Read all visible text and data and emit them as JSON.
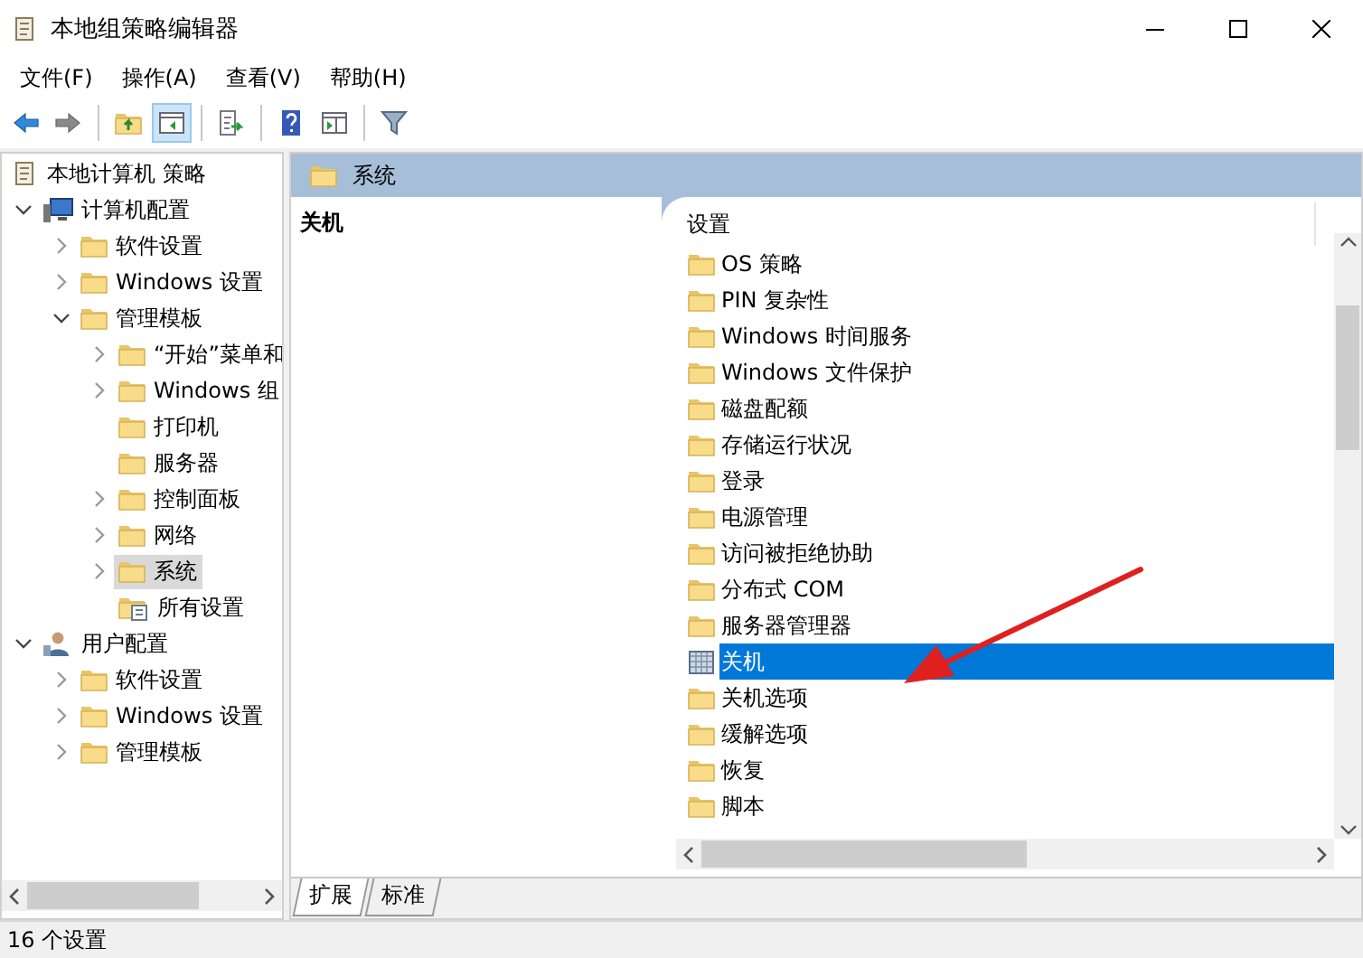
{
  "window": {
    "title": "本地组策略编辑器"
  },
  "menu": [
    {
      "label": "文件(F)"
    },
    {
      "label": "操作(A)"
    },
    {
      "label": "查看(V)"
    },
    {
      "label": "帮助(H)"
    }
  ],
  "toolbar": [
    {
      "kind": "back",
      "pressed": false
    },
    {
      "kind": "forward",
      "pressed": false
    },
    {
      "kind": "sep"
    },
    {
      "kind": "up",
      "pressed": false
    },
    {
      "kind": "tree",
      "pressed": true
    },
    {
      "kind": "sep"
    },
    {
      "kind": "export",
      "pressed": false
    },
    {
      "kind": "sep"
    },
    {
      "kind": "help",
      "pressed": false
    },
    {
      "kind": "panel",
      "pressed": false
    },
    {
      "kind": "sep"
    },
    {
      "kind": "filter",
      "pressed": false
    }
  ],
  "tree": {
    "root": {
      "label": "本地计算机 策略",
      "kind": "policy",
      "selected": false,
      "children": [
        {
          "label": "计算机配置",
          "kind": "computer",
          "expanded": true,
          "selected": false,
          "children": [
            {
              "label": "软件设置",
              "kind": "folder",
              "expanded": false,
              "selected": false
            },
            {
              "label": "Windows 设置",
              "kind": "folder",
              "expanded": false,
              "selected": false
            },
            {
              "label": "管理模板",
              "kind": "folder",
              "expanded": true,
              "selected": false,
              "children": [
                {
                  "label": "“开始”菜单和",
                  "kind": "folder",
                  "expanded": false,
                  "selected": false
                },
                {
                  "label": "Windows 组",
                  "kind": "folder",
                  "expanded": false,
                  "selected": false
                },
                {
                  "label": "打印机",
                  "kind": "folder",
                  "selected": false
                },
                {
                  "label": "服务器",
                  "kind": "folder",
                  "selected": false
                },
                {
                  "label": "控制面板",
                  "kind": "folder",
                  "expanded": false,
                  "selected": false
                },
                {
                  "label": "网络",
                  "kind": "folder",
                  "expanded": false,
                  "selected": false
                },
                {
                  "label": "系统",
                  "kind": "folder",
                  "expanded": false,
                  "selected": true
                },
                {
                  "label": "所有设置",
                  "kind": "settings",
                  "selected": false
                }
              ]
            }
          ]
        },
        {
          "label": "用户配置",
          "kind": "user",
          "expanded": true,
          "selected": false,
          "children": [
            {
              "label": "软件设置",
              "kind": "folder",
              "expanded": false,
              "selected": false
            },
            {
              "label": "Windows 设置",
              "kind": "folder",
              "expanded": false,
              "selected": false
            },
            {
              "label": "管理模板",
              "kind": "folder",
              "expanded": false,
              "selected": false
            }
          ]
        }
      ]
    }
  },
  "details": {
    "header": "系统",
    "description_title": "关机",
    "column": "设置",
    "items": [
      {
        "label": "OS 策略",
        "kind": "folder",
        "selected": false
      },
      {
        "label": "PIN 复杂性",
        "kind": "folder",
        "selected": false
      },
      {
        "label": "Windows 时间服务",
        "kind": "folder",
        "selected": false
      },
      {
        "label": "Windows 文件保护",
        "kind": "folder",
        "selected": false
      },
      {
        "label": "磁盘配额",
        "kind": "folder",
        "selected": false
      },
      {
        "label": "存储运行状况",
        "kind": "folder",
        "selected": false
      },
      {
        "label": "登录",
        "kind": "folder",
        "selected": false
      },
      {
        "label": "电源管理",
        "kind": "folder",
        "selected": false
      },
      {
        "label": "访问被拒绝协助",
        "kind": "folder",
        "selected": false
      },
      {
        "label": "分布式 COM",
        "kind": "folder",
        "selected": false
      },
      {
        "label": "服务器管理器",
        "kind": "folder",
        "selected": false
      },
      {
        "label": "关机",
        "kind": "page",
        "selected": true
      },
      {
        "label": "关机选项",
        "kind": "folder",
        "selected": false
      },
      {
        "label": "缓解选项",
        "kind": "folder",
        "selected": false
      },
      {
        "label": "恢复",
        "kind": "folder",
        "selected": false
      },
      {
        "label": "脚本",
        "kind": "folder",
        "selected": false
      }
    ],
    "tabs": [
      {
        "label": "扩展",
        "selected": true
      },
      {
        "label": "标准",
        "selected": false
      }
    ]
  },
  "status_bar": {
    "text": "16 个设置"
  }
}
